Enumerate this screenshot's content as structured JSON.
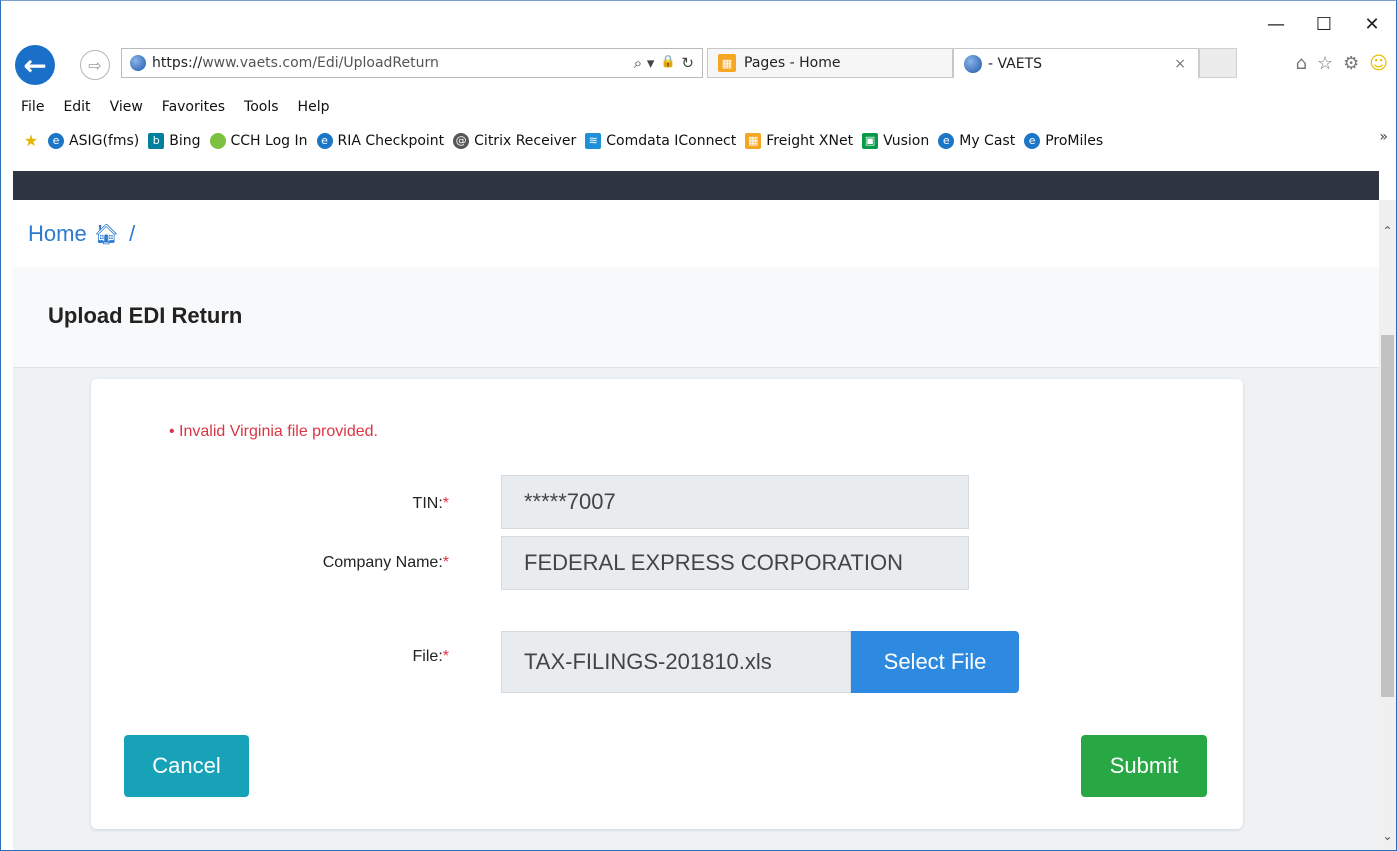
{
  "browser": {
    "url_scheme": "https://",
    "url_rest": "www.vaets.com/Edi/UploadReturn",
    "search_glyph": "⌕ ▾",
    "lock_glyph": "🔒",
    "refresh_glyph": "↻",
    "tabs": [
      {
        "title": "Pages - Home"
      },
      {
        "title": "- VAETS",
        "close": "×"
      }
    ],
    "window_controls": [
      "—",
      "☐",
      "✕"
    ],
    "tool_icons": [
      "⌂",
      "☆",
      "⚙",
      "☺"
    ]
  },
  "menu": [
    "File",
    "Edit",
    "View",
    "Favorites",
    "Tools",
    "Help"
  ],
  "favorites": [
    {
      "label": "ASIG(fms)",
      "icon": "ie-icon"
    },
    {
      "label": "Bing",
      "icon": "bing-icon",
      "glyph": "b"
    },
    {
      "label": "CCH Log In",
      "icon": "cch-icon"
    },
    {
      "label": "RIA Checkpoint",
      "icon": "ie-icon"
    },
    {
      "label": "Citrix Receiver",
      "icon": "citrix-icon"
    },
    {
      "label": "Comdata IConnect",
      "icon": "comdata-icon"
    },
    {
      "label": "Freight XNet",
      "icon": "orange-icon"
    },
    {
      "label": "Vusion",
      "icon": "vusion-icon"
    },
    {
      "label": "My Cast",
      "icon": "ie-icon"
    },
    {
      "label": "ProMiles",
      "icon": "ie-icon"
    }
  ],
  "favorites_more": "»",
  "page": {
    "breadcrumb_home": "Home",
    "breadcrumb_sep": "/",
    "title": "Upload EDI Return",
    "error": "•  Invalid Virginia file provided.",
    "form": {
      "tin_label": "TIN:",
      "tin_value": "*****7007",
      "company_label": "Company Name:",
      "company_value": "FEDERAL EXPRESS CORPORATION",
      "file_label": "File:",
      "file_value": "TAX-FILINGS-201810.xls",
      "required_mark": "*",
      "select_file": "Select File",
      "cancel": "Cancel",
      "submit": "Submit"
    }
  },
  "colors": {
    "accent": "#2d8ae0",
    "cancel": "#17a2b8",
    "submit": "#28a745",
    "error": "#dc3545",
    "navbar": "#2f3541"
  }
}
